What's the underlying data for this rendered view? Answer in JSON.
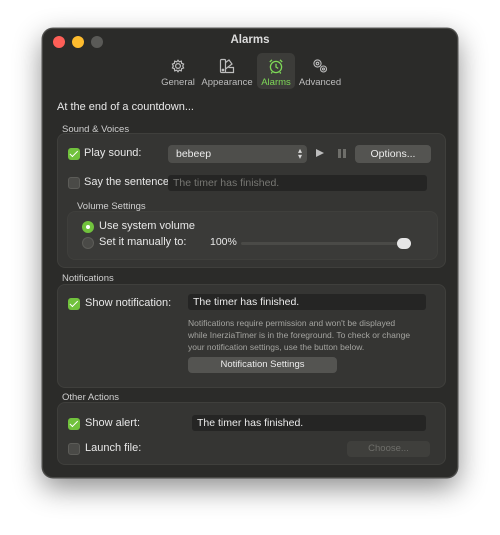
{
  "window": {
    "title": "Alarms"
  },
  "tabs": [
    {
      "label": "General",
      "icon": "gear-icon",
      "active": false
    },
    {
      "label": "Appearance",
      "icon": "palette-icon",
      "active": false
    },
    {
      "label": "Alarms",
      "icon": "alarm-clock-icon",
      "active": true
    },
    {
      "label": "Advanced",
      "icon": "gears-icon",
      "active": false
    }
  ],
  "heading": "At the end of a countdown...",
  "sound_voices": {
    "section_label": "Sound & Voices",
    "play_sound": {
      "label": "Play sound:",
      "checked": true,
      "selected_sound": "bebeep",
      "options_button": "Options..."
    },
    "say_sentence": {
      "label": "Say the sentence:",
      "checked": false,
      "placeholder": "The timer has finished."
    },
    "volume": {
      "label": "Volume Settings",
      "use_system": {
        "label": "Use system volume",
        "selected": true
      },
      "manual": {
        "label": "Set it manually to:",
        "selected": false,
        "value_text": "100%",
        "level": 1.0
      }
    }
  },
  "notifications": {
    "section_label": "Notifications",
    "show_notification": {
      "label": "Show notification:",
      "checked": true,
      "value": "The timer has finished."
    },
    "note": "Notifications require permission and won't be displayed\nwhile InerziaTimer is in the foreground. To check or change\nyour notification settings, use the button below.",
    "settings_button": "Notification Settings"
  },
  "other_actions": {
    "section_label": "Other Actions",
    "show_alert": {
      "label": "Show alert:",
      "checked": true,
      "value": "The timer has finished."
    },
    "launch_file": {
      "label": "Launch file:",
      "checked": false,
      "choose_button": "Choose..."
    }
  },
  "colors": {
    "accent": "#71c23d",
    "active_tab": "#7ed957",
    "window_bg": "#2b2b29",
    "panel_bg": "#353533"
  }
}
